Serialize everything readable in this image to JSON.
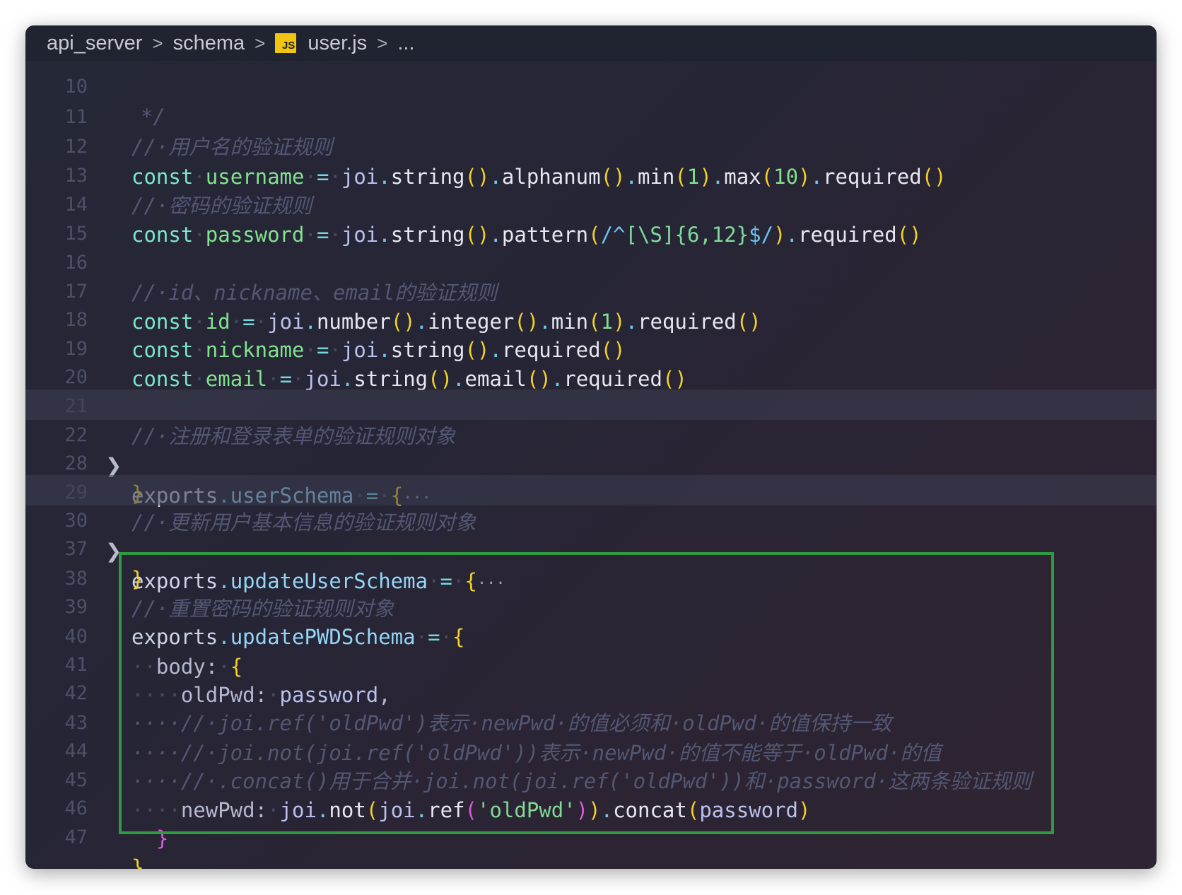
{
  "breadcrumb": {
    "items": [
      "api_server",
      "schema",
      "user.js",
      "..."
    ],
    "separator": ">",
    "file_icon_label": "JS"
  },
  "editor": {
    "partial_top_line_text": "*/",
    "partial_top_line_number": "10",
    "lines": [
      {
        "n": "11",
        "comment": "// 用户名的验证规则"
      },
      {
        "n": "12",
        "code": "const username = joi.string().alphanum().min(1).max(10).required()"
      },
      {
        "n": "13",
        "comment": "// 密码的验证规则"
      },
      {
        "n": "14",
        "code": "const password = joi.string().pattern(/^[\\S]{6,12}$/).required()"
      },
      {
        "n": "15",
        "code": ""
      },
      {
        "n": "16",
        "comment": "// id、nickname、email的验证规则"
      },
      {
        "n": "17",
        "code": "const id = joi.number().integer().min(1).required()"
      },
      {
        "n": "18",
        "code": "const nickname = joi.string().required()"
      },
      {
        "n": "19",
        "code": "const email = joi.string().email().required()"
      },
      {
        "n": "20",
        "code": ""
      },
      {
        "n": "21",
        "comment": "// 注册和登录表单的验证规则对象"
      },
      {
        "n": "22",
        "code": "exports.userSchema = {…",
        "folded": true
      },
      {
        "n": "28",
        "code": "}"
      },
      {
        "n": "29",
        "comment": "// 更新用户基本信息的验证规则对象"
      },
      {
        "n": "30",
        "code": "exports.updateUserSchema = {…",
        "folded": true
      },
      {
        "n": "37",
        "code": "}"
      },
      {
        "n": "38",
        "comment": "// 重置密码的验证规则对象"
      },
      {
        "n": "39",
        "code": "exports.updatePWDSchema = {"
      },
      {
        "n": "40",
        "code": "  body: {"
      },
      {
        "n": "41",
        "code": "    oldPwd: password,"
      },
      {
        "n": "42",
        "comment": "    // joi.ref('oldPwd')表示 newPwd 的值必须和 oldPwd 的值保持一致"
      },
      {
        "n": "43",
        "comment": "    // joi.not(joi.ref('oldPwd'))表示 newPwd 的值不能等于 oldPwd 的值"
      },
      {
        "n": "44",
        "comment": "    // .concat()用于合并 joi.not(joi.ref('oldPwd'))和 password 这两条验证规则"
      },
      {
        "n": "45",
        "code": "    newPwd: joi.not(joi.ref('oldPwd')).concat(password)"
      },
      {
        "n": "46",
        "code": "  }"
      },
      {
        "n": "47",
        "code": "}"
      }
    ]
  },
  "colors": {
    "highlight_box": "#2f9a3f",
    "keyword": "#7ce7c8",
    "comment": "#535773",
    "bracket_level1": "#f1d02a",
    "bracket_level2": "#d65ed8",
    "bracket_level3": "#50a8f0"
  }
}
